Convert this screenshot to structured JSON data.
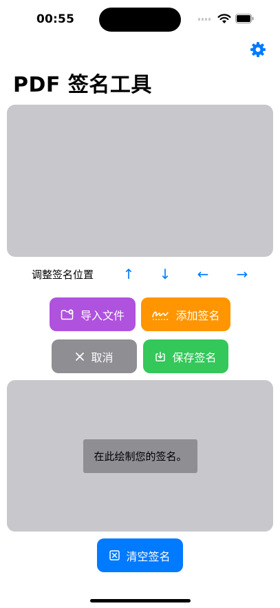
{
  "status_bar": {
    "time": "00:55"
  },
  "header": {
    "title": "PDF 签名工具",
    "settings_icon": "gear-icon"
  },
  "adjust": {
    "label": "调整签名位置",
    "up": "↑",
    "down": "↓",
    "left": "←",
    "right": "→"
  },
  "actions": {
    "import_label": "导入文件",
    "add_label": "添加签名",
    "cancel_label": "取消",
    "save_label": "保存签名",
    "clear_label": "清空签名"
  },
  "signature_pad": {
    "hint": "在此绘制您的签名。"
  },
  "colors": {
    "accent": "#007aff",
    "import": "#af52de",
    "add": "#ff9500",
    "cancel": "#8e8e93",
    "save": "#34c759",
    "panel": "#c8c8cc"
  }
}
